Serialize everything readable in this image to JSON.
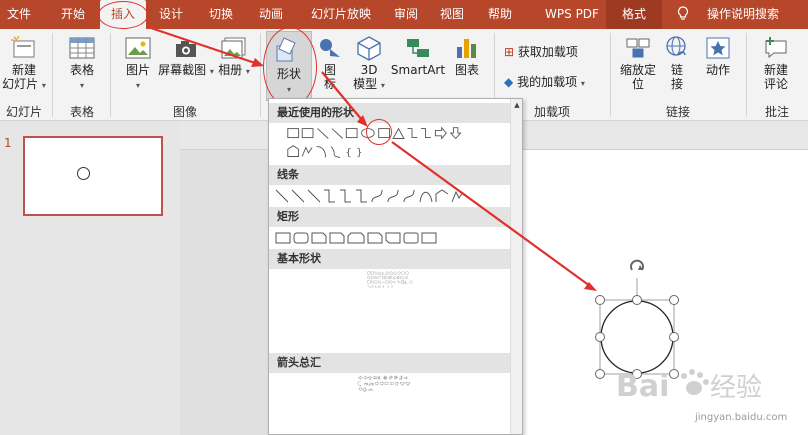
{
  "tabs": [
    {
      "label": "文件"
    },
    {
      "label": "开始"
    },
    {
      "label": "插入"
    },
    {
      "label": "设计"
    },
    {
      "label": "切换"
    },
    {
      "label": "动画"
    },
    {
      "label": "幻灯片放映"
    },
    {
      "label": "审阅"
    },
    {
      "label": "视图"
    },
    {
      "label": "帮助"
    },
    {
      "label": "WPS PDF"
    },
    {
      "label": "格式"
    }
  ],
  "tell_me": "操作说明搜索",
  "ribbon": {
    "new_slide": "新建\n幻灯片",
    "table": "表格",
    "picture": "图片",
    "screenshot": "屏幕截图",
    "album": "相册",
    "shapes": "形状",
    "icons": "图\n标",
    "model3d": "3D\n模型",
    "smartart": "SmartArt",
    "chart": "图表",
    "get_addins": "获取加载项",
    "my_addins": "我的加载项",
    "zoom": "缩放定\n位",
    "link": "链\n接",
    "action": "动作",
    "new_comment": "新建\n评论",
    "groups": {
      "slides": "幻灯片",
      "tables": "表格",
      "images": "图像",
      "addins": "加载项",
      "links": "链接",
      "comments": "批注"
    }
  },
  "shapes_panel": {
    "recent": "最近使用的形状",
    "lines": "线条",
    "rectangles": "矩形",
    "basic": "基本形状",
    "arrows": "箭头总汇"
  },
  "slide_number": "1",
  "colors": {
    "accent": "#b7472a",
    "annotation": "#e0322c"
  },
  "watermark": {
    "brand_text": "Bai",
    "brand_cn": "经验",
    "site": "jingyan.baidu.com"
  }
}
